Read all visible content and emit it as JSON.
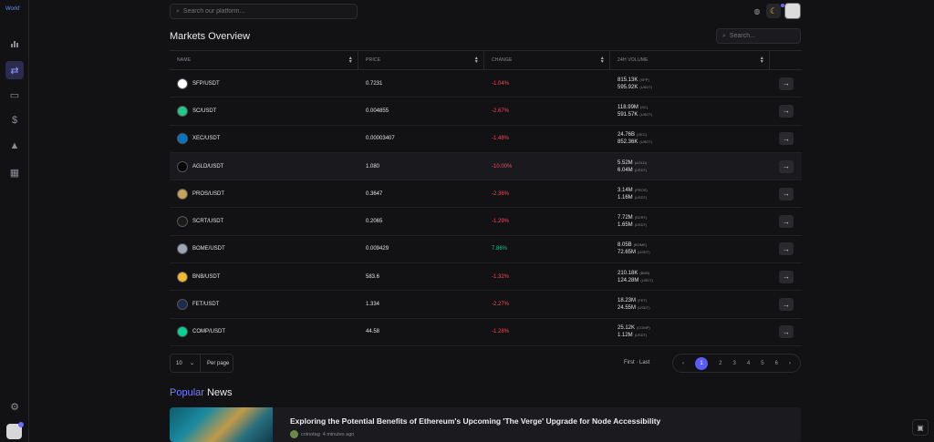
{
  "logo": {
    "alt": "Workf"
  },
  "sidebar": {
    "icons": [
      "chart-bars-icon",
      "exchange-icon",
      "map-icon",
      "dollar-circle-icon",
      "wallet-icon",
      "calendar-grid-icon",
      "settings-icon"
    ]
  },
  "search": {
    "placeholder": "Search our platform..."
  },
  "topbar": {
    "icons": [
      "globe-icon",
      "video-icon",
      "bell-icon",
      "moon-icon"
    ]
  },
  "markets": {
    "title": "Markets Overview",
    "search_placeholder": "Search...",
    "columns": [
      "NAME",
      "PRICE",
      "CHANGE",
      "24H VOLUME"
    ],
    "rows": [
      {
        "pair": "SFP/USDT",
        "price": "0.7231",
        "change": "-1.04%",
        "vol1": "815.13K",
        "u1": "(SFP)",
        "vol2": "595.92K",
        "u2": "(USDT)",
        "icon_color": "#ffffff",
        "change_color": "#ef4c5a"
      },
      {
        "pair": "SC/USDT",
        "price": "0.004855",
        "change": "-2.67%",
        "vol1": "118.99M",
        "u1": "(SC)",
        "vol2": "591.57K",
        "u2": "(USDT)",
        "icon_color": "#20c98b",
        "change_color": "#ef4c5a"
      },
      {
        "pair": "XEC/USDT",
        "price": "0.00003407",
        "change": "-1.48%",
        "vol1": "24.76B",
        "u1": "(XEC)",
        "vol2": "852.36K",
        "u2": "(USDT)",
        "icon_color": "#0074c2",
        "change_color": "#ef4c5a"
      },
      {
        "pair": "AGLD/USDT",
        "price": "1.080",
        "change": "-10.00%",
        "vol1": "5.52M",
        "u1": "(AGLD)",
        "vol2": "6.04M",
        "u2": "(USDT)",
        "icon_color": "#000000",
        "change_color": "#ef4c5a"
      },
      {
        "pair": "PROS/USDT",
        "price": "0.3647",
        "change": "-2.36%",
        "vol1": "3.14M",
        "u1": "(PROS)",
        "vol2": "1.16M",
        "u2": "(USDT)",
        "icon_color": "#c8a45a",
        "change_color": "#ef4c5a"
      },
      {
        "pair": "SCRT/USDT",
        "price": "0.2065",
        "change": "-1.29%",
        "vol1": "7.72M",
        "u1": "(SCRT)",
        "vol2": "1.65M",
        "u2": "(USDT)",
        "icon_color": "#1a1a1a",
        "change_color": "#ef4c5a"
      },
      {
        "pair": "BOME/USDT",
        "price": "0.009429",
        "change": "7.86%",
        "vol1": "8.05B",
        "u1": "(BOME)",
        "vol2": "72.65M",
        "u2": "(USDT)",
        "icon_color": "#9aa7b8",
        "change_color": "#22c08a"
      },
      {
        "pair": "BNB/USDT",
        "price": "583.6",
        "change": "-1.32%",
        "vol1": "210.18K",
        "u1": "(BNB)",
        "vol2": "124.28M",
        "u2": "(USDT)",
        "icon_color": "#f3ba2f",
        "change_color": "#ef4c5a"
      },
      {
        "pair": "FET/USDT",
        "price": "1.334",
        "change": "-2.27%",
        "vol1": "18.23M",
        "u1": "(FET)",
        "vol2": "24.55M",
        "u2": "(USDT)",
        "icon_color": "#1d2a4f",
        "change_color": "#ef4c5a"
      },
      {
        "pair": "COMP/USDT",
        "price": "44.58",
        "change": "-1.28%",
        "vol1": "25.12K",
        "u1": "(COMP)",
        "vol2": "1.12M",
        "u2": "(USDT)",
        "icon_color": "#00d395",
        "change_color": "#ef4c5a"
      }
    ]
  },
  "pagination": {
    "per_page_value": "10",
    "per_page_label": "Per page",
    "first_last": "First · Last",
    "pages": [
      "1",
      "2",
      "3",
      "4",
      "5",
      "6"
    ],
    "current": "1"
  },
  "popular": {
    "title_accent": "Popular",
    "title_rest": "News"
  },
  "news": {
    "title": "Exploring the Potential Benefits of Ethereum's Upcoming 'The Verge' Upgrade for Node Accessibility",
    "author": "coinotag",
    "time": "4 minutes ago"
  }
}
